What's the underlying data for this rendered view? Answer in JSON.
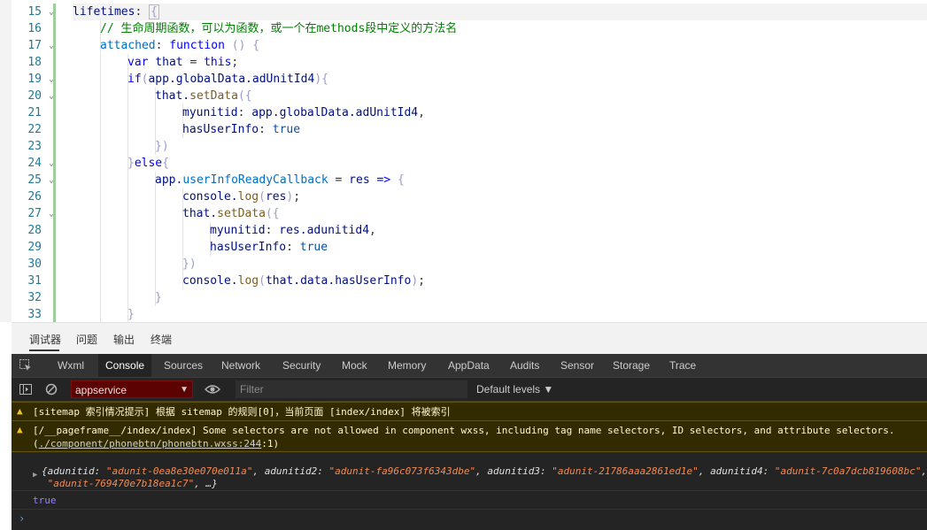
{
  "editor": {
    "lines": [
      {
        "n": "15",
        "fold": "⌄",
        "indent": 1,
        "hl": true,
        "tokens": [
          [
            "pr",
            "lifetimes"
          ],
          [
            "pu",
            ": "
          ],
          [
            "cursor",
            "{"
          ]
        ]
      },
      {
        "n": "16",
        "fold": "",
        "indent": 2,
        "tokens": [
          [
            "cm",
            "// 生命周期函数，可以为函数，或一个在methods段中定义的方法名"
          ]
        ]
      },
      {
        "n": "17",
        "fold": "⌄",
        "indent": 2,
        "tokens": [
          [
            "ak",
            "attached"
          ],
          [
            "pu",
            ": "
          ],
          [
            "kw",
            "function"
          ],
          [
            "pu",
            " "
          ],
          [
            "br",
            "() {"
          ]
        ]
      },
      {
        "n": "18",
        "fold": "",
        "indent": 3,
        "tokens": [
          [
            "kw",
            "var"
          ],
          [
            "pr",
            " that"
          ],
          [
            "pu",
            " = "
          ],
          [
            "kw",
            "this"
          ],
          [
            "pu",
            ";"
          ]
        ]
      },
      {
        "n": "19",
        "fold": "⌄",
        "indent": 3,
        "tokens": [
          [
            "kw",
            "if"
          ],
          [
            "br",
            "("
          ],
          [
            "pr",
            "app.globalData.adUnitId4"
          ],
          [
            "br",
            ")"
          ],
          [
            "br",
            "{"
          ]
        ]
      },
      {
        "n": "20",
        "fold": "⌄",
        "indent": 4,
        "tokens": [
          [
            "pr",
            "that."
          ],
          [
            "fn",
            "setData"
          ],
          [
            "br",
            "({"
          ]
        ]
      },
      {
        "n": "21",
        "fold": "",
        "indent": 5,
        "tokens": [
          [
            "pr",
            "myunitid"
          ],
          [
            "pu",
            ": "
          ],
          [
            "pr",
            "app.globalData.adUnitId4"
          ],
          [
            "pu",
            ","
          ]
        ]
      },
      {
        "n": "22",
        "fold": "",
        "indent": 5,
        "tokens": [
          [
            "pr",
            "hasUserInfo"
          ],
          [
            "pu",
            ": "
          ],
          [
            "bl",
            "true"
          ]
        ]
      },
      {
        "n": "23",
        "fold": "",
        "indent": 4,
        "tokens": [
          [
            "br",
            "})"
          ]
        ]
      },
      {
        "n": "24",
        "fold": "⌄",
        "indent": 3,
        "tokens": [
          [
            "br",
            "}"
          ],
          [
            "kw",
            "else"
          ],
          [
            "br",
            "{"
          ]
        ]
      },
      {
        "n": "25",
        "fold": "⌄",
        "indent": 4,
        "tokens": [
          [
            "pr",
            "app."
          ],
          [
            "ak",
            "userInfoReadyCallback"
          ],
          [
            "pu",
            " = "
          ],
          [
            "pr",
            "res"
          ],
          [
            "pu",
            " "
          ],
          [
            "kw",
            "=>"
          ],
          [
            "pu",
            " "
          ],
          [
            "br",
            "{"
          ]
        ]
      },
      {
        "n": "26",
        "fold": "",
        "indent": 5,
        "tokens": [
          [
            "pr",
            "console."
          ],
          [
            "fn",
            "log"
          ],
          [
            "br",
            "("
          ],
          [
            "pr",
            "res"
          ],
          [
            "br",
            ")"
          ],
          [
            "pu",
            ";"
          ]
        ]
      },
      {
        "n": "27",
        "fold": "⌄",
        "indent": 5,
        "tokens": [
          [
            "pr",
            "that."
          ],
          [
            "fn",
            "setData"
          ],
          [
            "br",
            "({"
          ]
        ]
      },
      {
        "n": "28",
        "fold": "",
        "indent": 6,
        "tokens": [
          [
            "pr",
            "myunitid"
          ],
          [
            "pu",
            ": "
          ],
          [
            "pr",
            "res.adunitid4"
          ],
          [
            "pu",
            ","
          ]
        ]
      },
      {
        "n": "29",
        "fold": "",
        "indent": 6,
        "tokens": [
          [
            "pr",
            "hasUserInfo"
          ],
          [
            "pu",
            ": "
          ],
          [
            "bl",
            "true"
          ]
        ]
      },
      {
        "n": "30",
        "fold": "",
        "indent": 5,
        "tokens": [
          [
            "br",
            "})"
          ]
        ]
      },
      {
        "n": "31",
        "fold": "",
        "indent": 5,
        "tokens": [
          [
            "pr",
            "console."
          ],
          [
            "fn",
            "log"
          ],
          [
            "br",
            "("
          ],
          [
            "pr",
            "that.data.hasUserInfo"
          ],
          [
            "br",
            ")"
          ],
          [
            "pu",
            ";"
          ]
        ]
      },
      {
        "n": "32",
        "fold": "",
        "indent": 4,
        "tokens": [
          [
            "br",
            "}"
          ]
        ]
      },
      {
        "n": "33",
        "fold": "",
        "indent": 3,
        "tokens": [
          [
            "br",
            "}"
          ]
        ]
      }
    ]
  },
  "panel_tabs": [
    "调试器",
    "问题",
    "输出",
    "终端"
  ],
  "devtools": {
    "tabs": [
      "Wxml",
      "Console",
      "Sources",
      "Network",
      "Security",
      "Mock",
      "Memory",
      "AppData",
      "Audits",
      "Sensor",
      "Storage",
      "Trace"
    ],
    "active_tab": "Console",
    "context": "appservice",
    "filter_placeholder": "Filter",
    "levels": "Default levels ▼"
  },
  "console": {
    "warn1": "[sitemap 索引情况提示] 根据 sitemap 的规则[0]，当前页面 [index/index] 将被索引",
    "warn2_text": "[/__pageframe__/index/index] Some selectors are not allowed in component wxss, including tag name selectors, ID selectors, and attribute selectors.",
    "warn2_prefix": "(",
    "warn2_link": "./component/phonebtn/phonebtn.wxss:244",
    "warn2_suffix": ":1)",
    "object_entries": [
      {
        "key": "adunitid",
        "val": "\"adunit-0ea8e30e070e011a\""
      },
      {
        "key": "adunitid2",
        "val": "\"adunit-fa96c073f6343dbe\""
      },
      {
        "key": "adunitid3",
        "val": "\"adunit-21786aaa2861ed1e\""
      },
      {
        "key": "adunitid4",
        "val": "\"adunit-7c0a7dcb819608bc\""
      }
    ],
    "object_line2_val": "\"adunit-769470e7b18ea1c7\"",
    "object_more": ", …}",
    "true_value": "true"
  },
  "icons": {
    "warning": "warning-icon",
    "prompt": "prompt-chevron-icon",
    "inspect": "inspect-element-icon",
    "sidebar_toggle": "console-sidebar-icon",
    "clear": "clear-console-icon",
    "eye": "live-expression-icon"
  }
}
